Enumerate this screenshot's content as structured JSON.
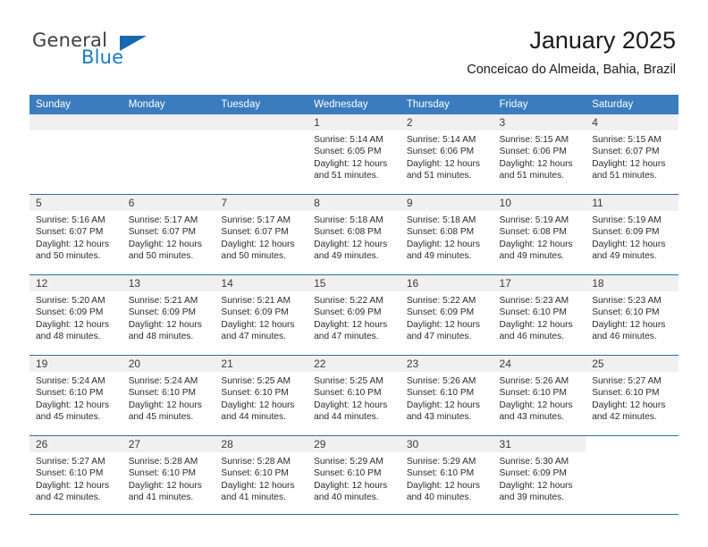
{
  "brand": {
    "name_part1": "General",
    "name_part2": "Blue"
  },
  "header": {
    "title": "January 2025",
    "subtitle": "Conceicao do Almeida, Bahia, Brazil"
  },
  "calendar": {
    "weekday_headers": [
      "Sunday",
      "Monday",
      "Tuesday",
      "Wednesday",
      "Thursday",
      "Friday",
      "Saturday"
    ],
    "colors": {
      "header_blue": "#3a7cbe",
      "row_rule": "#2e6da4",
      "daynum_band": "#f0f0f0",
      "brand_blue": "#1a7bc4"
    },
    "weeks": [
      [
        {
          "day": "",
          "empty": true
        },
        {
          "day": "",
          "empty": true
        },
        {
          "day": "",
          "empty": true
        },
        {
          "day": "1",
          "sunrise": "Sunrise: 5:14 AM",
          "sunset": "Sunset: 6:05 PM",
          "daylight_line1": "Daylight: 12 hours",
          "daylight_line2": "and 51 minutes."
        },
        {
          "day": "2",
          "sunrise": "Sunrise: 5:14 AM",
          "sunset": "Sunset: 6:06 PM",
          "daylight_line1": "Daylight: 12 hours",
          "daylight_line2": "and 51 minutes."
        },
        {
          "day": "3",
          "sunrise": "Sunrise: 5:15 AM",
          "sunset": "Sunset: 6:06 PM",
          "daylight_line1": "Daylight: 12 hours",
          "daylight_line2": "and 51 minutes."
        },
        {
          "day": "4",
          "sunrise": "Sunrise: 5:15 AM",
          "sunset": "Sunset: 6:07 PM",
          "daylight_line1": "Daylight: 12 hours",
          "daylight_line2": "and 51 minutes."
        }
      ],
      [
        {
          "day": "5",
          "sunrise": "Sunrise: 5:16 AM",
          "sunset": "Sunset: 6:07 PM",
          "daylight_line1": "Daylight: 12 hours",
          "daylight_line2": "and 50 minutes."
        },
        {
          "day": "6",
          "sunrise": "Sunrise: 5:17 AM",
          "sunset": "Sunset: 6:07 PM",
          "daylight_line1": "Daylight: 12 hours",
          "daylight_line2": "and 50 minutes."
        },
        {
          "day": "7",
          "sunrise": "Sunrise: 5:17 AM",
          "sunset": "Sunset: 6:07 PM",
          "daylight_line1": "Daylight: 12 hours",
          "daylight_line2": "and 50 minutes."
        },
        {
          "day": "8",
          "sunrise": "Sunrise: 5:18 AM",
          "sunset": "Sunset: 6:08 PM",
          "daylight_line1": "Daylight: 12 hours",
          "daylight_line2": "and 49 minutes."
        },
        {
          "day": "9",
          "sunrise": "Sunrise: 5:18 AM",
          "sunset": "Sunset: 6:08 PM",
          "daylight_line1": "Daylight: 12 hours",
          "daylight_line2": "and 49 minutes."
        },
        {
          "day": "10",
          "sunrise": "Sunrise: 5:19 AM",
          "sunset": "Sunset: 6:08 PM",
          "daylight_line1": "Daylight: 12 hours",
          "daylight_line2": "and 49 minutes."
        },
        {
          "day": "11",
          "sunrise": "Sunrise: 5:19 AM",
          "sunset": "Sunset: 6:09 PM",
          "daylight_line1": "Daylight: 12 hours",
          "daylight_line2": "and 49 minutes."
        }
      ],
      [
        {
          "day": "12",
          "sunrise": "Sunrise: 5:20 AM",
          "sunset": "Sunset: 6:09 PM",
          "daylight_line1": "Daylight: 12 hours",
          "daylight_line2": "and 48 minutes."
        },
        {
          "day": "13",
          "sunrise": "Sunrise: 5:21 AM",
          "sunset": "Sunset: 6:09 PM",
          "daylight_line1": "Daylight: 12 hours",
          "daylight_line2": "and 48 minutes."
        },
        {
          "day": "14",
          "sunrise": "Sunrise: 5:21 AM",
          "sunset": "Sunset: 6:09 PM",
          "daylight_line1": "Daylight: 12 hours",
          "daylight_line2": "and 47 minutes."
        },
        {
          "day": "15",
          "sunrise": "Sunrise: 5:22 AM",
          "sunset": "Sunset: 6:09 PM",
          "daylight_line1": "Daylight: 12 hours",
          "daylight_line2": "and 47 minutes."
        },
        {
          "day": "16",
          "sunrise": "Sunrise: 5:22 AM",
          "sunset": "Sunset: 6:09 PM",
          "daylight_line1": "Daylight: 12 hours",
          "daylight_line2": "and 47 minutes."
        },
        {
          "day": "17",
          "sunrise": "Sunrise: 5:23 AM",
          "sunset": "Sunset: 6:10 PM",
          "daylight_line1": "Daylight: 12 hours",
          "daylight_line2": "and 46 minutes."
        },
        {
          "day": "18",
          "sunrise": "Sunrise: 5:23 AM",
          "sunset": "Sunset: 6:10 PM",
          "daylight_line1": "Daylight: 12 hours",
          "daylight_line2": "and 46 minutes."
        }
      ],
      [
        {
          "day": "19",
          "sunrise": "Sunrise: 5:24 AM",
          "sunset": "Sunset: 6:10 PM",
          "daylight_line1": "Daylight: 12 hours",
          "daylight_line2": "and 45 minutes."
        },
        {
          "day": "20",
          "sunrise": "Sunrise: 5:24 AM",
          "sunset": "Sunset: 6:10 PM",
          "daylight_line1": "Daylight: 12 hours",
          "daylight_line2": "and 45 minutes."
        },
        {
          "day": "21",
          "sunrise": "Sunrise: 5:25 AM",
          "sunset": "Sunset: 6:10 PM",
          "daylight_line1": "Daylight: 12 hours",
          "daylight_line2": "and 44 minutes."
        },
        {
          "day": "22",
          "sunrise": "Sunrise: 5:25 AM",
          "sunset": "Sunset: 6:10 PM",
          "daylight_line1": "Daylight: 12 hours",
          "daylight_line2": "and 44 minutes."
        },
        {
          "day": "23",
          "sunrise": "Sunrise: 5:26 AM",
          "sunset": "Sunset: 6:10 PM",
          "daylight_line1": "Daylight: 12 hours",
          "daylight_line2": "and 43 minutes."
        },
        {
          "day": "24",
          "sunrise": "Sunrise: 5:26 AM",
          "sunset": "Sunset: 6:10 PM",
          "daylight_line1": "Daylight: 12 hours",
          "daylight_line2": "and 43 minutes."
        },
        {
          "day": "25",
          "sunrise": "Sunrise: 5:27 AM",
          "sunset": "Sunset: 6:10 PM",
          "daylight_line1": "Daylight: 12 hours",
          "daylight_line2": "and 42 minutes."
        }
      ],
      [
        {
          "day": "26",
          "sunrise": "Sunrise: 5:27 AM",
          "sunset": "Sunset: 6:10 PM",
          "daylight_line1": "Daylight: 12 hours",
          "daylight_line2": "and 42 minutes."
        },
        {
          "day": "27",
          "sunrise": "Sunrise: 5:28 AM",
          "sunset": "Sunset: 6:10 PM",
          "daylight_line1": "Daylight: 12 hours",
          "daylight_line2": "and 41 minutes."
        },
        {
          "day": "28",
          "sunrise": "Sunrise: 5:28 AM",
          "sunset": "Sunset: 6:10 PM",
          "daylight_line1": "Daylight: 12 hours",
          "daylight_line2": "and 41 minutes."
        },
        {
          "day": "29",
          "sunrise": "Sunrise: 5:29 AM",
          "sunset": "Sunset: 6:10 PM",
          "daylight_line1": "Daylight: 12 hours",
          "daylight_line2": "and 40 minutes."
        },
        {
          "day": "30",
          "sunrise": "Sunrise: 5:29 AM",
          "sunset": "Sunset: 6:10 PM",
          "daylight_line1": "Daylight: 12 hours",
          "daylight_line2": "and 40 minutes."
        },
        {
          "day": "31",
          "sunrise": "Sunrise: 5:30 AM",
          "sunset": "Sunset: 6:09 PM",
          "daylight_line1": "Daylight: 12 hours",
          "daylight_line2": "and 39 minutes."
        },
        {
          "day": "",
          "empty": true,
          "blank_cell": true
        }
      ]
    ]
  }
}
